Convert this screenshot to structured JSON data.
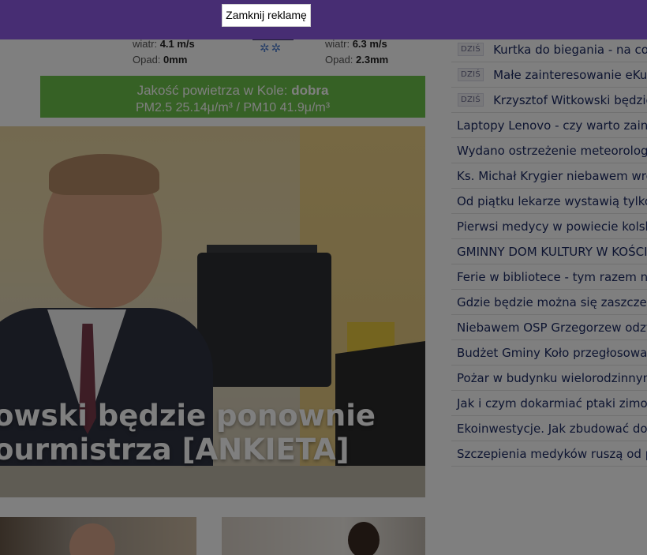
{
  "ad": {
    "close_label": "Zamknij reklamę"
  },
  "weather": {
    "left": {
      "wind_label": "wiatr:",
      "wind_value": "4.1 m/s",
      "rain_label": "Opad:",
      "rain_value": "0mm"
    },
    "right": {
      "wind_label": "wiatr:",
      "wind_value": "6.3 m/s",
      "rain_label": "Opad:",
      "rain_value": "2.3mm"
    },
    "icon": "snow-cloud-icon"
  },
  "air_quality": {
    "label": "Jakość powietrza w Kole:",
    "status": "dobra",
    "pm_line": "PM2.5 25.14μ/m³ / PM10 41.9μ/m³"
  },
  "hero": {
    "caption_line1": "owski będzie ponownie",
    "caption_line2": "ourmistrza [ANKIETA]"
  },
  "news": {
    "today_tag": "DZIŚ",
    "today_items": [
      "Kurtka do biegania - na co",
      "Małe zainteresowanie eKure",
      "Krzysztof Witkowski będzie p"
    ],
    "items": [
      "Laptopy Lenovo - czy warto zain",
      "Wydano ostrzeżenie meteorolog",
      "Ks. Michał Krygier niebawem wro",
      "Od piątku lekarze wystawią tylko",
      "Pierwsi medycy w powiecie kolsk",
      "GMINNY DOM KULTURY W KOŚCIEL",
      "Ferie w bibliotece - tym razem n",
      "Gdzie będzie można się zaszczep",
      "Niebawem OSP Grzegorzew odzy",
      "Budżet Gminy Koło przegłosowan",
      "Pożar w budynku wielorodzinnym",
      "Jak i czym dokarmiać ptaki zimo",
      "Ekoinwestycje. Jak zbudować do",
      "Szczepienia medyków ruszą od p"
    ]
  },
  "colors": {
    "ad_bar": "#472d73",
    "air_quality_bg": "#6cc24a",
    "news_text": "#1d2b63",
    "overlay": "rgba(0,0,0,0.5)"
  }
}
